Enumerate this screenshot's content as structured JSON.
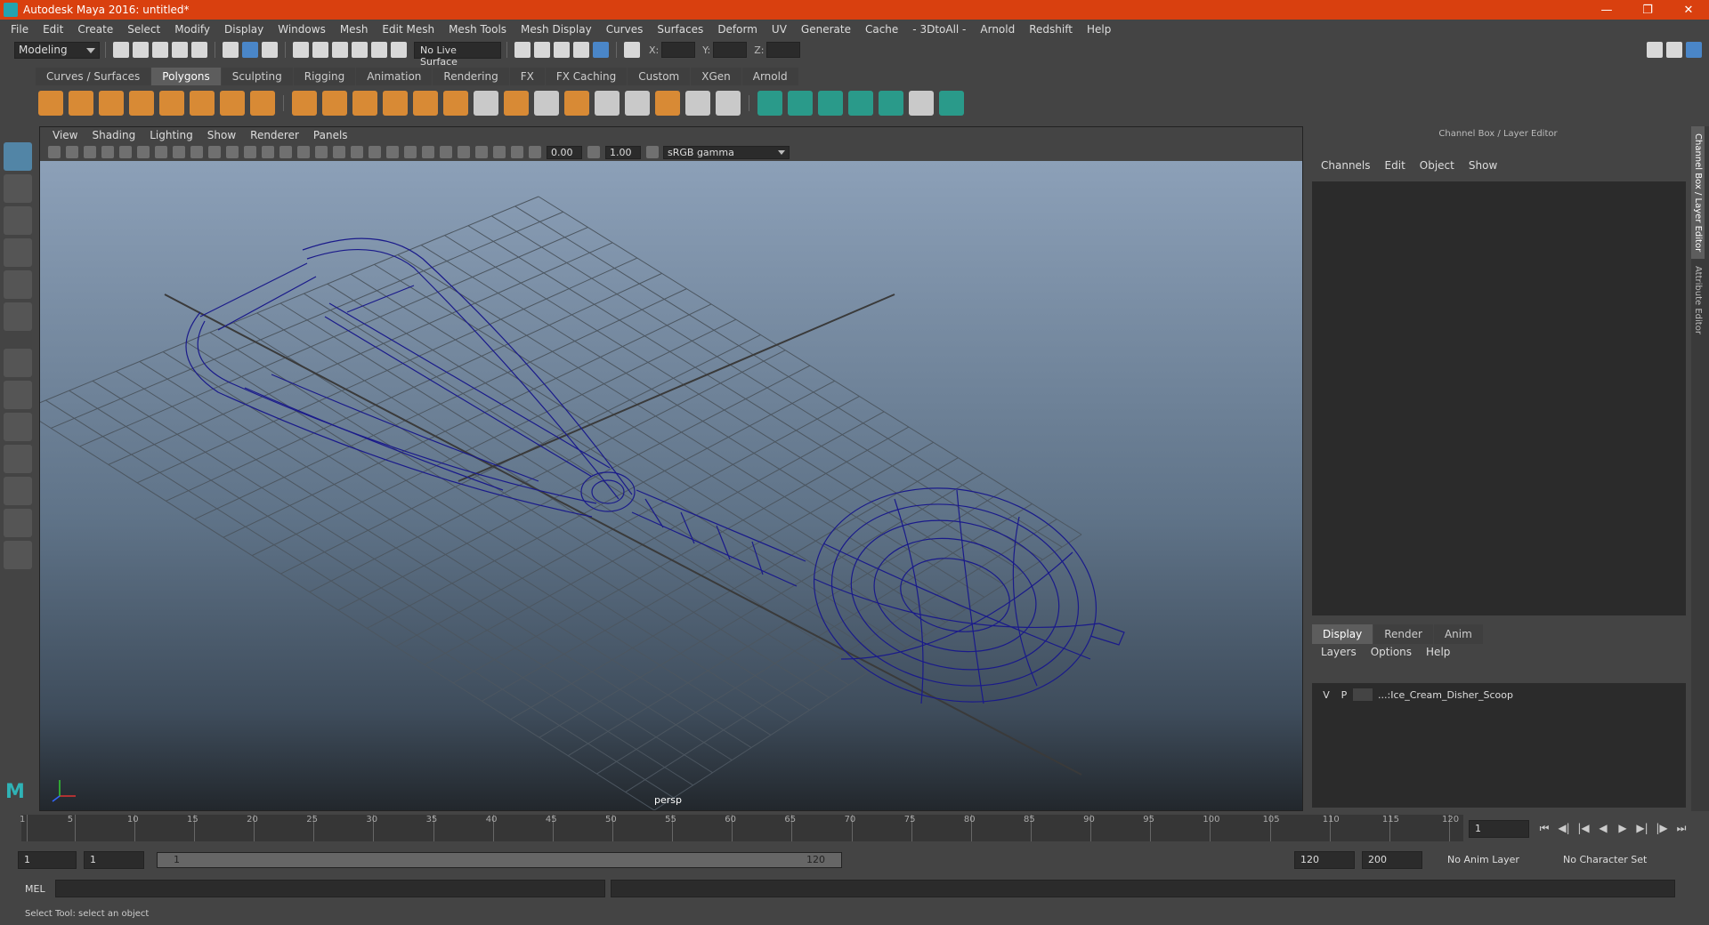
{
  "window": {
    "title": "Autodesk Maya 2016: untitled*"
  },
  "menubar": [
    "File",
    "Edit",
    "Create",
    "Select",
    "Modify",
    "Display",
    "Windows",
    "Mesh",
    "Edit Mesh",
    "Mesh Tools",
    "Mesh Display",
    "Curves",
    "Surfaces",
    "Deform",
    "UV",
    "Generate",
    "Cache",
    "- 3DtoAll -",
    "Arnold",
    "Redshift",
    "Help"
  ],
  "statusline": {
    "mode": "Modeling",
    "live_surface": "No Live Surface",
    "x_label": "X:",
    "y_label": "Y:",
    "z_label": "Z:"
  },
  "shelf_tabs": [
    "Curves / Surfaces",
    "Polygons",
    "Sculpting",
    "Rigging",
    "Animation",
    "Rendering",
    "FX",
    "FX Caching",
    "Custom",
    "XGen",
    "Arnold"
  ],
  "shelf_active": "Polygons",
  "panel_menu": [
    "View",
    "Shading",
    "Lighting",
    "Show",
    "Renderer",
    "Panels"
  ],
  "panel_fields": {
    "exposure": "0.00",
    "gamma": "1.00",
    "color_space": "sRGB gamma"
  },
  "camera_label": "persp",
  "channel_box": {
    "title": "Channel Box / Layer Editor",
    "menu": [
      "Channels",
      "Edit",
      "Object",
      "Show"
    ]
  },
  "layer_editor": {
    "tabs": [
      "Display",
      "Render",
      "Anim"
    ],
    "active_tab": "Display",
    "menu": [
      "Layers",
      "Options",
      "Help"
    ],
    "layer": {
      "v": "V",
      "p": "P",
      "name": "...:Ice_Cream_Disher_Scoop"
    }
  },
  "side_tabs": [
    "Channel Box / Layer Editor",
    "Attribute Editor"
  ],
  "timeline": {
    "ticks": [
      "1",
      "5",
      "10",
      "15",
      "20",
      "25",
      "30",
      "35",
      "40",
      "45",
      "50",
      "55",
      "60",
      "65",
      "70",
      "75",
      "80",
      "85",
      "90",
      "95",
      "100",
      "105",
      "110",
      "115",
      "120"
    ],
    "current_frame": "1"
  },
  "range": {
    "start": "1",
    "playback_start": "1",
    "slider_start": "1",
    "slider_end": "120",
    "playback_end": "120",
    "end": "200",
    "anim_layer": "No Anim Layer",
    "character_set": "No Character Set"
  },
  "mel_label": "MEL",
  "help_line": "Select Tool: select an object"
}
